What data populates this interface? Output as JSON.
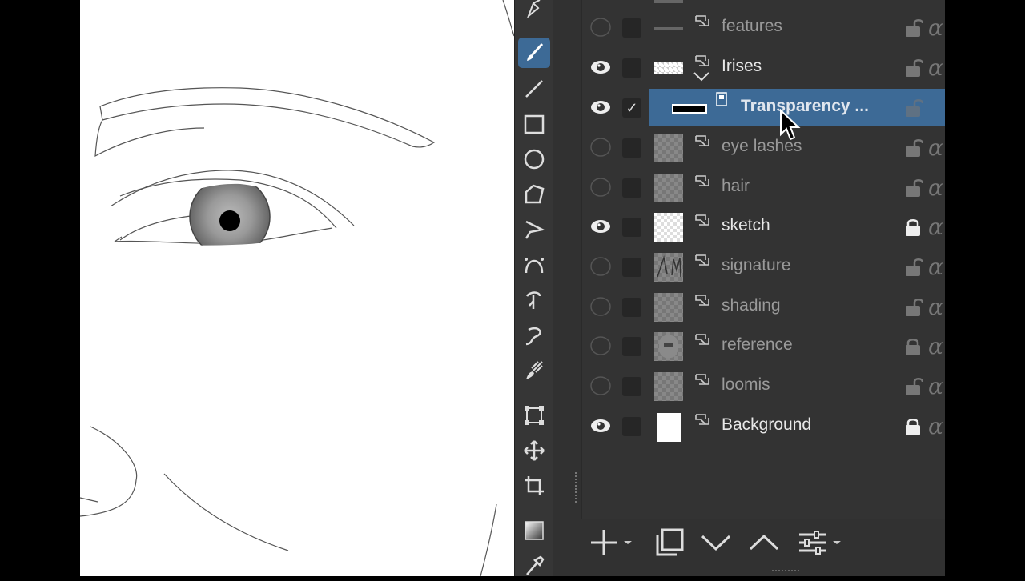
{
  "tools": [
    {
      "name": "calligraphy-pen-icon"
    },
    {
      "name": "freehand-brush-icon",
      "active": true
    },
    {
      "name": "line-tool-icon"
    },
    {
      "name": "rectangle-tool-icon"
    },
    {
      "name": "ellipse-tool-icon"
    },
    {
      "name": "polygon-tool-icon"
    },
    {
      "name": "polyline-tool-icon"
    },
    {
      "name": "bezier-curve-icon"
    },
    {
      "name": "freehand-path-icon"
    },
    {
      "name": "dynamic-brush-icon"
    },
    {
      "name": "multibrush-icon"
    },
    {
      "name": "transform-tool-icon"
    },
    {
      "name": "move-tool-icon"
    },
    {
      "name": "crop-tool-icon"
    },
    {
      "name": "gradient-tool-icon"
    },
    {
      "name": "color-picker-icon"
    }
  ],
  "layers": [
    {
      "name": "features",
      "visible": false,
      "checked": false,
      "thumb": "line",
      "locked": false,
      "dim": true
    },
    {
      "name": "Irises",
      "visible": true,
      "checked": false,
      "thumb": "strip",
      "locked": false,
      "dim": false,
      "expanded": true
    },
    {
      "name": "Transparency ...",
      "visible": true,
      "checked": true,
      "thumb": "mask",
      "locked": false,
      "dim": false,
      "selected": true,
      "child": true
    },
    {
      "name": "eye lashes",
      "visible": false,
      "checked": false,
      "thumb": "checker",
      "locked": false,
      "dim": true
    },
    {
      "name": "hair",
      "visible": false,
      "checked": false,
      "thumb": "checker",
      "locked": false,
      "dim": true
    },
    {
      "name": "sketch",
      "visible": true,
      "checked": false,
      "thumb": "light",
      "locked": true,
      "dim": false
    },
    {
      "name": "signature",
      "visible": false,
      "checked": false,
      "thumb": "signature",
      "locked": false,
      "dim": true
    },
    {
      "name": "shading",
      "visible": false,
      "checked": false,
      "thumb": "checker",
      "locked": false,
      "dim": true
    },
    {
      "name": "reference",
      "visible": false,
      "checked": false,
      "thumb": "photo",
      "locked": true,
      "dim": true
    },
    {
      "name": "loomis",
      "visible": false,
      "checked": false,
      "thumb": "checker",
      "locked": false,
      "dim": true
    },
    {
      "name": "Background",
      "visible": true,
      "checked": false,
      "thumb": "white",
      "locked": true,
      "dim": false
    }
  ],
  "colors": {
    "accent": "#3d6a96",
    "panel": "#333333",
    "toolbox": "#363636"
  }
}
